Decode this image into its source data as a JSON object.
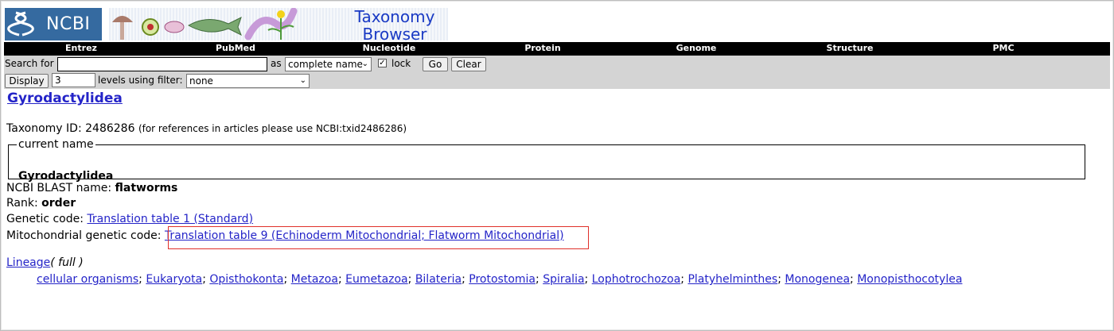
{
  "banner": {
    "logo_text": "NCBI",
    "title_line1": "Taxonomy",
    "title_line2": "Browser"
  },
  "nav": [
    "Entrez",
    "PubMed",
    "Nucleotide",
    "Protein",
    "Genome",
    "Structure",
    "PMC"
  ],
  "search": {
    "search_label": "Search for",
    "search_value": "",
    "as_label": "as",
    "as_selected": "complete name",
    "lock_label": "lock",
    "lock_checked": true,
    "go_label": "Go",
    "clear_label": "Clear",
    "display_label": "Display",
    "levels_value": "3",
    "levels_label": "levels using filter:",
    "filter_selected": "none"
  },
  "taxon": {
    "name": "Gyrodactylidea",
    "taxonomy_id_label": "Taxonomy ID:",
    "taxonomy_id": "2486286",
    "reference_note": "(for references in articles please use NCBI:txid2486286)",
    "current_name_legend": "current name",
    "current_name": "Gyrodactylidea",
    "blast_label": "NCBI BLAST name:",
    "blast_name": "flatworms",
    "rank_label": "Rank:",
    "rank": "order",
    "genetic_code_label": "Genetic code:",
    "genetic_code": "Translation table 1 (Standard)",
    "mito_code_label": "Mitochondrial genetic code:",
    "mito_code": "Translation table 9 (Echinoderm Mitochondrial; Flatworm Mitochondrial)"
  },
  "lineage": {
    "label": "Lineage",
    "mode": "( full )",
    "items": [
      "cellular organisms",
      "Eukaryota",
      "Opisthokonta",
      "Metazoa",
      "Eumetazoa",
      "Bilateria",
      "Protostomia",
      "Spiralia",
      "Lophotrochozoa",
      "Platyhelminthes",
      "Monogenea",
      "Monopisthocotylea"
    ],
    "separator": ";"
  },
  "colors": {
    "logo_bg": "#356aa0",
    "link": "#2424c8",
    "nav_bg": "#000000",
    "panel_bg": "#d4d4d4",
    "highlight_box": "#e0302a"
  }
}
